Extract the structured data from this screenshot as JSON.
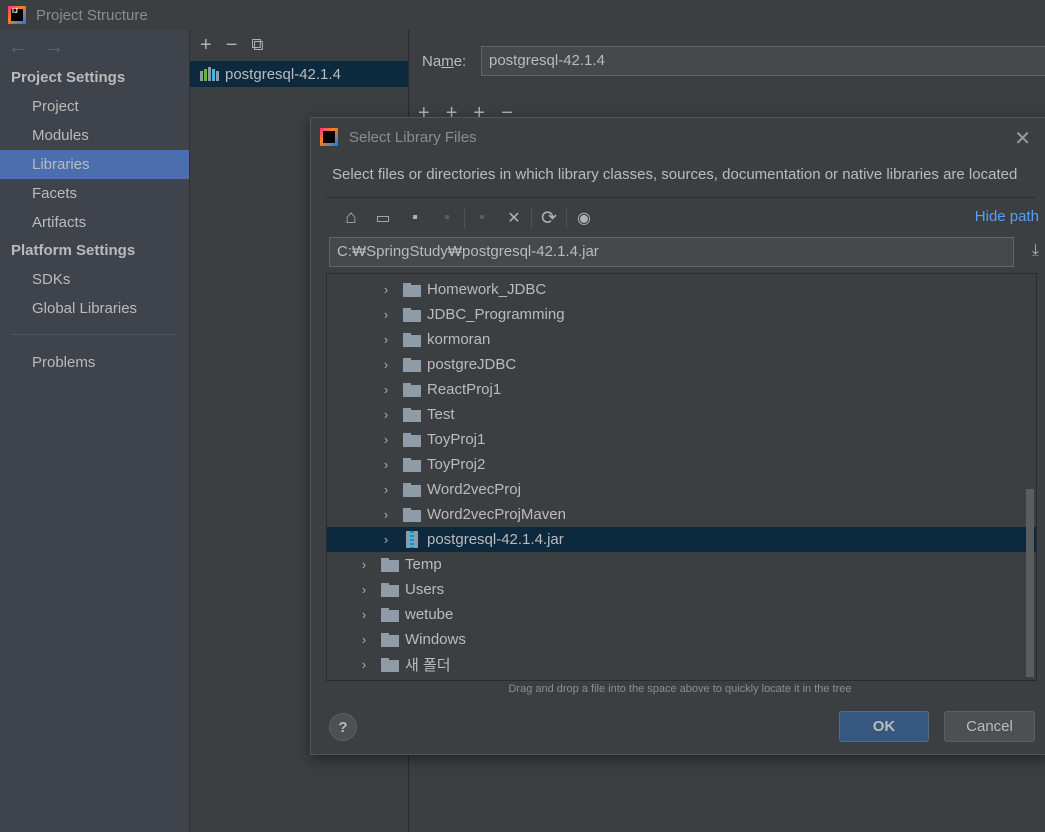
{
  "window": {
    "title": "Project Structure",
    "logo_text": "IJ"
  },
  "nav": {
    "back_icon": "←",
    "forward_icon": "→",
    "sections": [
      {
        "label": "Project Settings"
      },
      {
        "label": "Platform Settings"
      }
    ],
    "project_items": [
      "Project",
      "Modules",
      "Libraries",
      "Facets",
      "Artifacts"
    ],
    "platform_items": [
      "SDKs",
      "Global Libraries"
    ],
    "problems": "Problems",
    "selected": "Libraries"
  },
  "libraries": {
    "toolbar": {
      "add": "+",
      "remove": "−",
      "copy": "⧉"
    },
    "items": [
      {
        "label": "postgresql-42.1.4",
        "selected": true
      }
    ]
  },
  "details": {
    "name_label_pre": "Na",
    "name_label_ul": "m",
    "name_label_post": "e:",
    "name_value": "postgresql-42.1.4",
    "toolbar": [
      "+",
      "+",
      "+",
      "−"
    ]
  },
  "dialog": {
    "title": "Select Library Files",
    "close_icon": "✕",
    "description": "Select files or directories in which library classes, sources, documentation or native libraries are located",
    "toolbar": {
      "home": "⌂",
      "desktop": "▭",
      "project": "▪",
      "module": "▪",
      "new_folder": "▪",
      "delete": "✕",
      "refresh": "⟳",
      "show_hidden": "◉"
    },
    "hide_path": "Hide path",
    "path_value": "C:₩SpringStudy₩postgresql-42.1.4.jar",
    "download_icon": "⤓",
    "tree": [
      {
        "label": "Homework_JDBC",
        "type": "folder",
        "level": 2
      },
      {
        "label": "JDBC_Programming",
        "type": "folder",
        "level": 2
      },
      {
        "label": "kormoran",
        "type": "folder",
        "level": 2
      },
      {
        "label": "postgreJDBC",
        "type": "folder",
        "level": 2
      },
      {
        "label": "ReactProj1",
        "type": "folder",
        "level": 2
      },
      {
        "label": "Test",
        "type": "folder",
        "level": 2
      },
      {
        "label": "ToyProj1",
        "type": "folder",
        "level": 2
      },
      {
        "label": "ToyProj2",
        "type": "folder",
        "level": 2
      },
      {
        "label": "Word2vecProj",
        "type": "folder",
        "level": 2
      },
      {
        "label": "Word2vecProjMaven",
        "type": "folder",
        "level": 2
      },
      {
        "label": "postgresql-42.1.4.jar",
        "type": "jar",
        "level": 2,
        "selected": true
      },
      {
        "label": "Temp",
        "type": "folder",
        "level": 1
      },
      {
        "label": "Users",
        "type": "folder",
        "level": 1
      },
      {
        "label": "wetube",
        "type": "folder",
        "level": 1
      },
      {
        "label": "Windows",
        "type": "folder",
        "level": 1
      },
      {
        "label": "새 폴더",
        "type": "folder",
        "level": 1
      }
    ],
    "chevron": "›",
    "drag_hint": "Drag and drop a file into the space above to quickly locate it in the tree",
    "help": "?",
    "ok": "OK",
    "cancel": "Cancel"
  },
  "colors": {
    "accent_selected_nav": "#4b6eaf",
    "selected_row": "#0d293e",
    "link": "#589df6",
    "ok_button": "#365880"
  }
}
